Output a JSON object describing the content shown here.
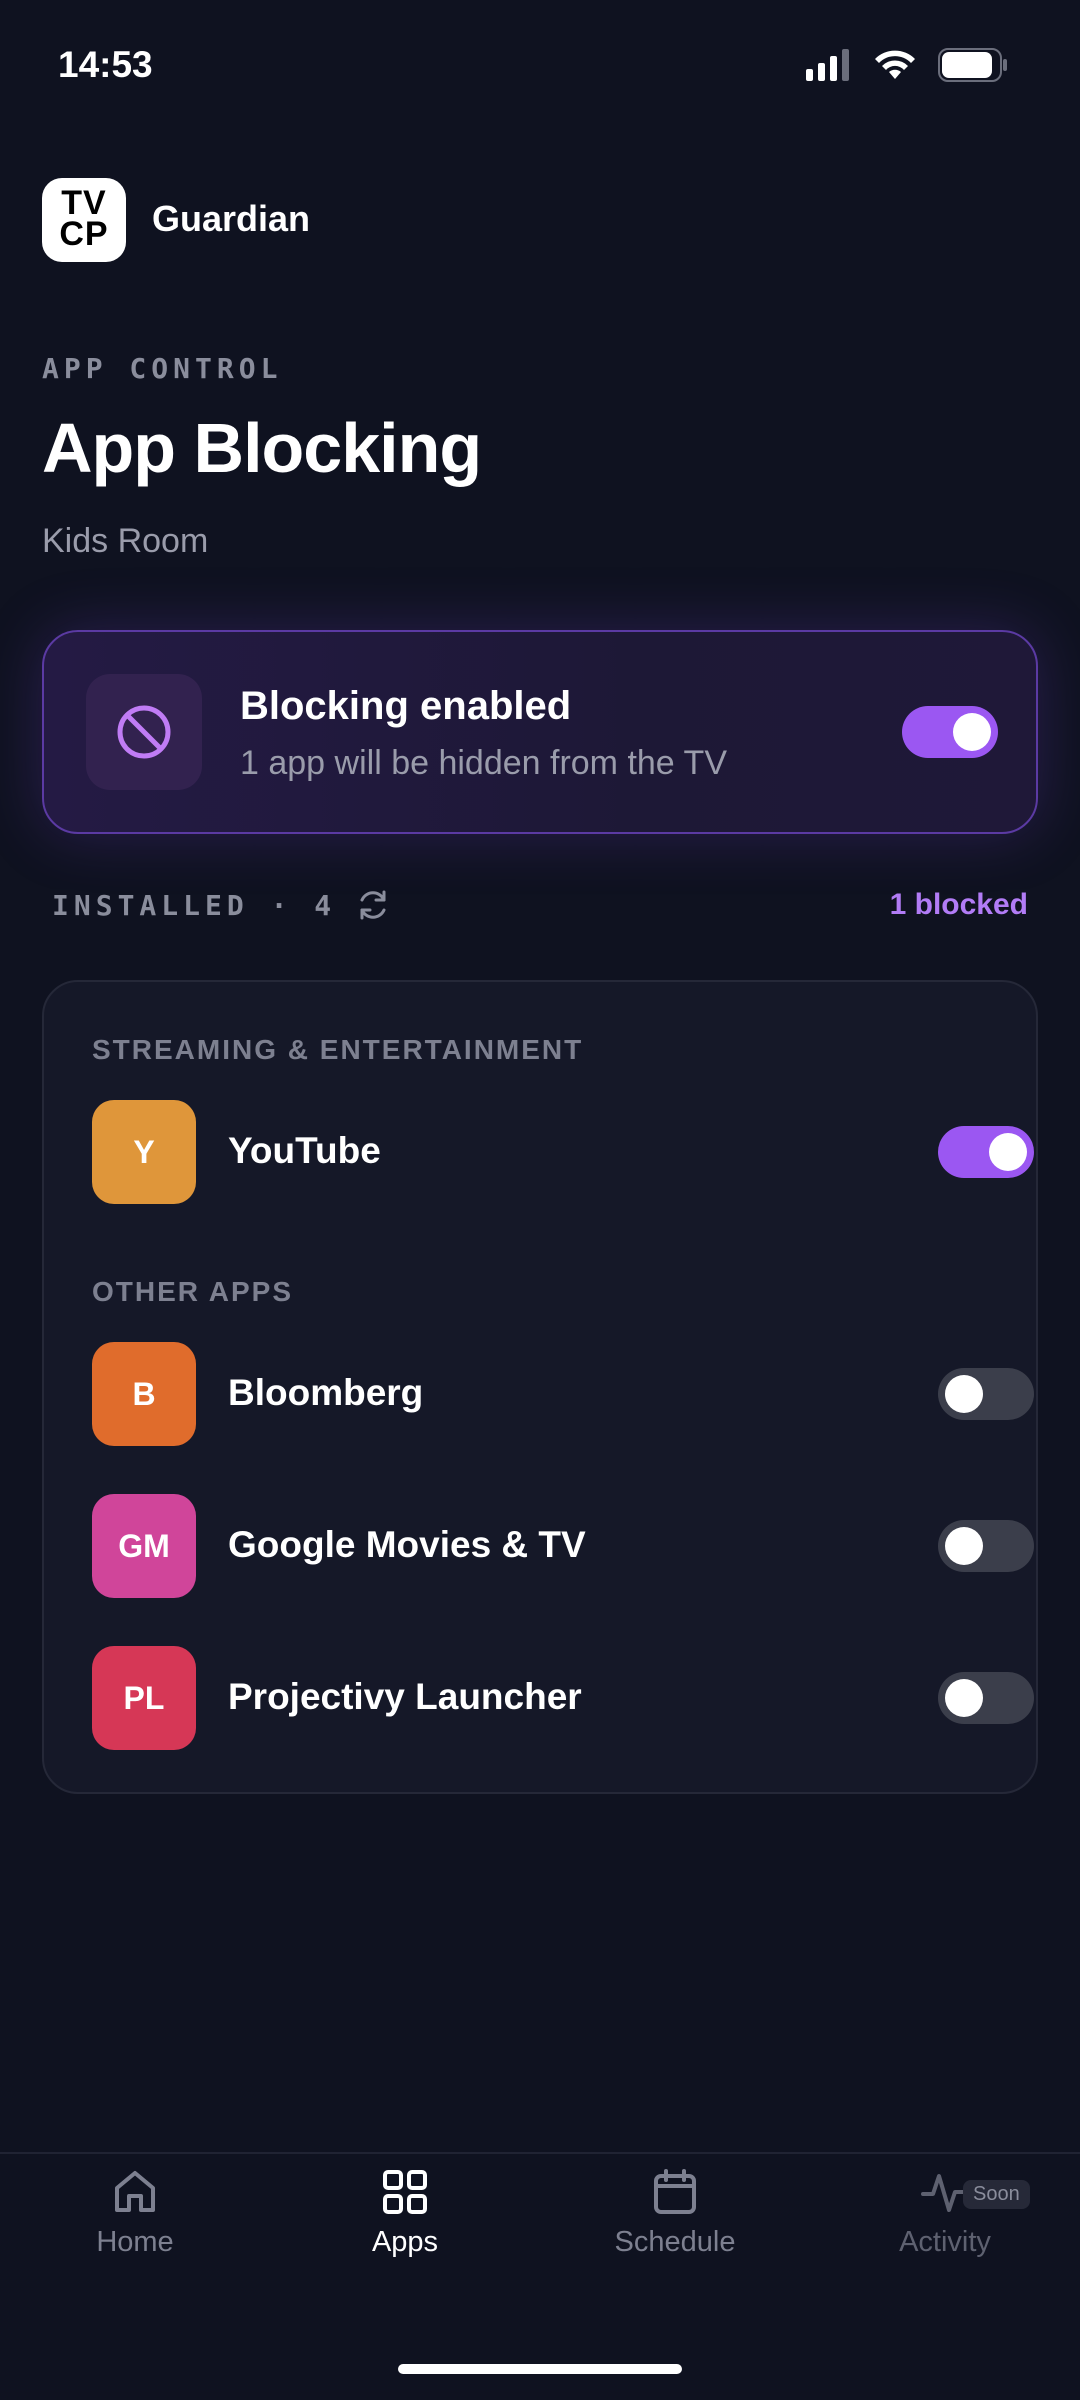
{
  "status_bar": {
    "time": "14:53"
  },
  "header": {
    "logo_text_line1": "TV",
    "logo_text_line2": "CP",
    "app_name": "Guardian"
  },
  "page": {
    "eyebrow": "APP CONTROL",
    "title": "App Blocking",
    "subtitle": "Kids Room"
  },
  "blocking_card": {
    "title": "Blocking enabled",
    "description": "1 app will be hidden from the TV",
    "enabled": true
  },
  "installed": {
    "label": "INSTALLED · 4",
    "blocked_label": "1 blocked"
  },
  "sections": [
    {
      "label": "STREAMING & ENTERTAINMENT",
      "apps": [
        {
          "initials": "Y",
          "name": "YouTube",
          "color": "#df963a",
          "blocked": true
        }
      ]
    },
    {
      "label": "OTHER APPS",
      "apps": [
        {
          "initials": "B",
          "name": "Bloomberg",
          "color": "#e06c2c",
          "blocked": false
        },
        {
          "initials": "GM",
          "name": "Google Movies & TV",
          "color": "#d0459a",
          "blocked": false
        },
        {
          "initials": "PL",
          "name": "Projectivy Launcher",
          "color": "#d63756",
          "blocked": false
        }
      ]
    }
  ],
  "tab_bar": {
    "tabs": [
      {
        "label": "Home",
        "icon": "home-icon",
        "active": false
      },
      {
        "label": "Apps",
        "icon": "grid-icon",
        "active": true
      },
      {
        "label": "Schedule",
        "icon": "calendar-icon",
        "active": false
      },
      {
        "label": "Activity",
        "icon": "activity-icon",
        "active": false,
        "badge": "Soon"
      }
    ]
  },
  "colors": {
    "accent": "#9b57f2",
    "accent_text": "#b27cf6",
    "background": "#0f1220",
    "card": "#151828"
  }
}
